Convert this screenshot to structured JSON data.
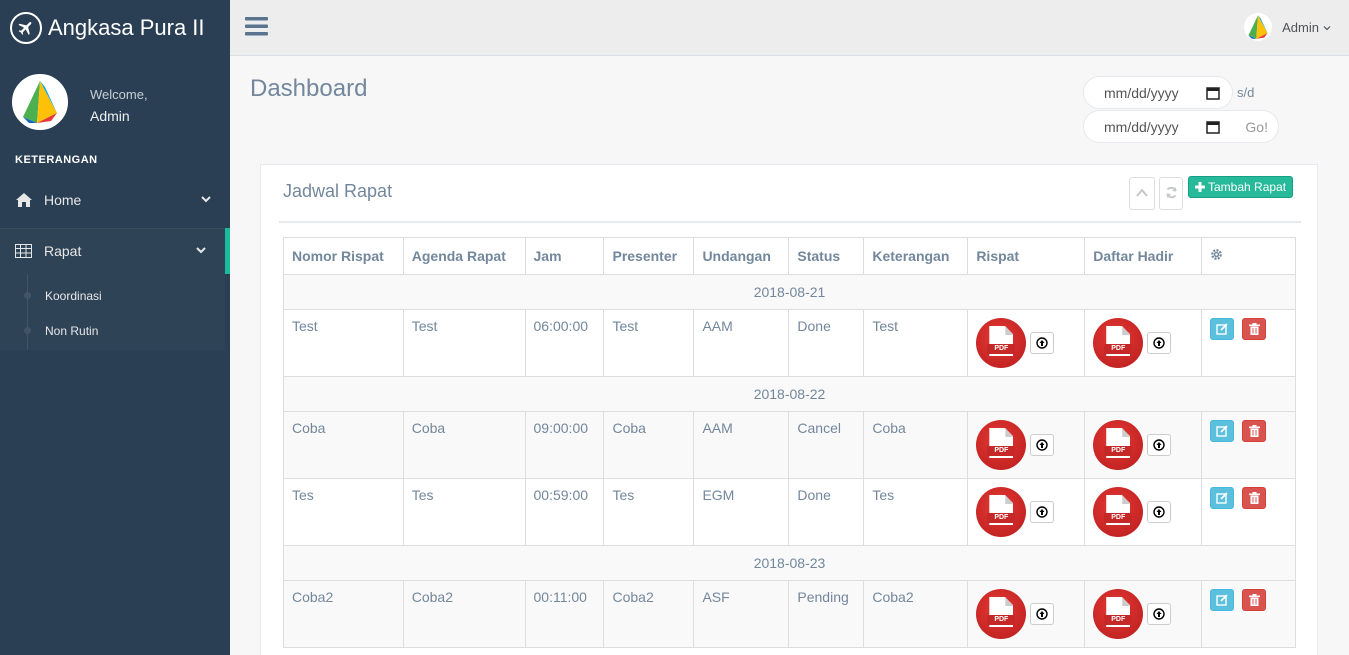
{
  "brand": {
    "title": "Angkasa Pura II"
  },
  "profile": {
    "welcome": "Welcome,",
    "name": "Admin"
  },
  "sidebar": {
    "section": "KETERANGAN",
    "items": [
      {
        "label": "Home",
        "icon": "home-icon"
      },
      {
        "label": "Rapat",
        "icon": "table-icon"
      }
    ],
    "subitems": [
      {
        "label": "Koordinasi"
      },
      {
        "label": "Non Rutin"
      }
    ]
  },
  "topbar": {
    "user": "Admin"
  },
  "page": {
    "title": "Dashboard"
  },
  "filter": {
    "date_placeholder": "mm/dd/yyyy",
    "sd_label": "s/d",
    "go_label": "Go!"
  },
  "panel": {
    "title": "Jadwal Rapat",
    "add_label": "Tambah Rapat"
  },
  "table": {
    "headers": [
      "Nomor Rispat",
      "Agenda Rapat",
      "Jam",
      "Presenter",
      "Undangan",
      "Status",
      "Keterangan",
      "Rispat",
      "Daftar Hadir"
    ],
    "groups": [
      {
        "date": "2018-08-21",
        "rows": [
          {
            "nomor": "Test",
            "agenda": "Test",
            "jam": "06:00:00",
            "presenter": "Test",
            "undangan": "AAM",
            "status": "Done",
            "keterangan": "Test"
          }
        ]
      },
      {
        "date": "2018-08-22",
        "rows": [
          {
            "nomor": "Coba",
            "agenda": "Coba",
            "jam": "09:00:00",
            "presenter": "Coba",
            "undangan": "AAM",
            "status": "Cancel",
            "keterangan": "Coba"
          },
          {
            "nomor": "Tes",
            "agenda": "Tes",
            "jam": "00:59:00",
            "presenter": "Tes",
            "undangan": "EGM",
            "status": "Done",
            "keterangan": "Tes"
          }
        ]
      },
      {
        "date": "2018-08-23",
        "rows": [
          {
            "nomor": "Coba2",
            "agenda": "Coba2",
            "jam": "00:11:00",
            "presenter": "Coba2",
            "undangan": "ASF",
            "status": "Pending",
            "keterangan": "Coba2"
          }
        ]
      }
    ],
    "pdf_label": "PDF"
  },
  "colors": {
    "sidebar": "#2a3f54",
    "accent": "#1abb9c",
    "add_button": "#26b99a",
    "edit": "#5bc0de",
    "delete": "#d9534f",
    "pdf": "#c62828"
  }
}
